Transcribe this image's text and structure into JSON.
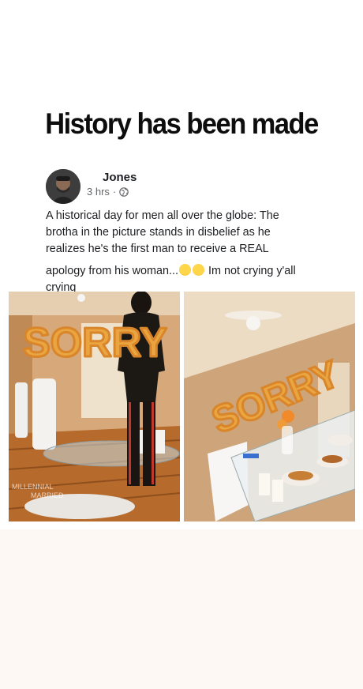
{
  "meme": {
    "headline": "History has been made"
  },
  "post": {
    "author": "Jones",
    "time": "3 hrs",
    "separator": "·",
    "audience_icon": "globe-icon",
    "lines": [
      "A historical day for men all over the globe: The",
      "brotha in the picture stands in disbelief as he",
      "realizes he's the first man to receive a REAL"
    ],
    "line4_before": "apology from his woman...",
    "line4_after": " Im not crying y'all",
    "line5": "crying",
    "emojis": [
      "dizzy-face-emoji",
      "weary-face-emoji"
    ]
  },
  "photos": {
    "left_balloon_text": "SORRY",
    "right_balloon_text": "SORRY",
    "watermark_line1": "MILLENNIAL",
    "watermark_line2": "MARRIED"
  },
  "colors": {
    "balloon_gold": "#e0922e",
    "wall_beige": "#d9b78f",
    "floor_wood": "#b9712f",
    "background": "#fdf8f4"
  }
}
